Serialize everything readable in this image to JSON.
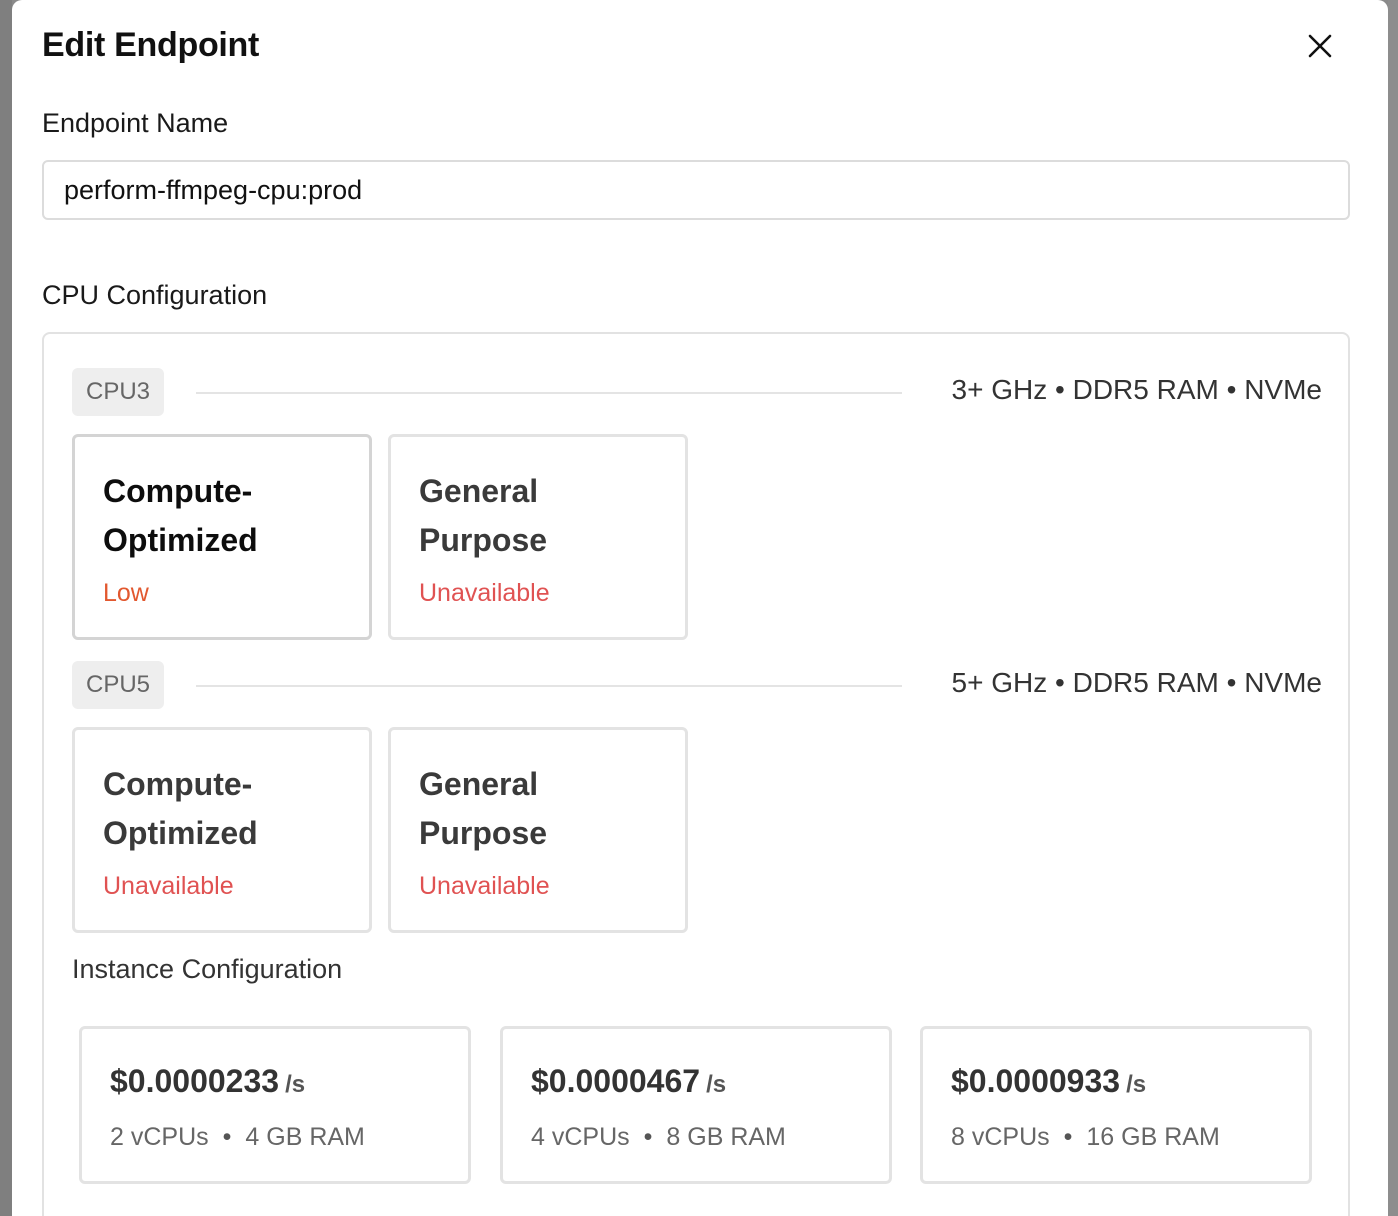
{
  "modal": {
    "title": "Edit Endpoint"
  },
  "endpoint_name": {
    "label": "Endpoint Name",
    "value": "perform-ffmpeg-cpu:prod"
  },
  "cpu_config": {
    "label": "CPU Configuration",
    "tiers": [
      {
        "badge": "CPU3",
        "spec": "3+ GHz • DDR5 RAM • NVMe",
        "types": [
          {
            "name": "Compute-Optimized",
            "status": "Low",
            "selected": true
          },
          {
            "name": "General Purpose",
            "status": "Unavailable",
            "selected": false
          }
        ]
      },
      {
        "badge": "CPU5",
        "spec": "5+ GHz • DDR5 RAM • NVMe",
        "types": [
          {
            "name": "Compute-Optimized",
            "status": "Unavailable",
            "selected": false
          },
          {
            "name": "General Purpose",
            "status": "Unavailable",
            "selected": false
          }
        ]
      }
    ]
  },
  "instance_config": {
    "label": "Instance Configuration",
    "instances": [
      {
        "price": "$0.0000233",
        "unit": "/s",
        "vcpus": "2 vCPUs",
        "ram": "4 GB RAM"
      },
      {
        "price": "$0.0000467",
        "unit": "/s",
        "vcpus": "4 vCPUs",
        "ram": "8 GB RAM"
      },
      {
        "price": "$0.0000933",
        "unit": "/s",
        "vcpus": "8 vCPUs",
        "ram": "16 GB RAM"
      }
    ]
  },
  "icons": {
    "close": "close-icon"
  },
  "colors": {
    "status_low": "#e2582f",
    "status_unavailable": "#e05252"
  }
}
